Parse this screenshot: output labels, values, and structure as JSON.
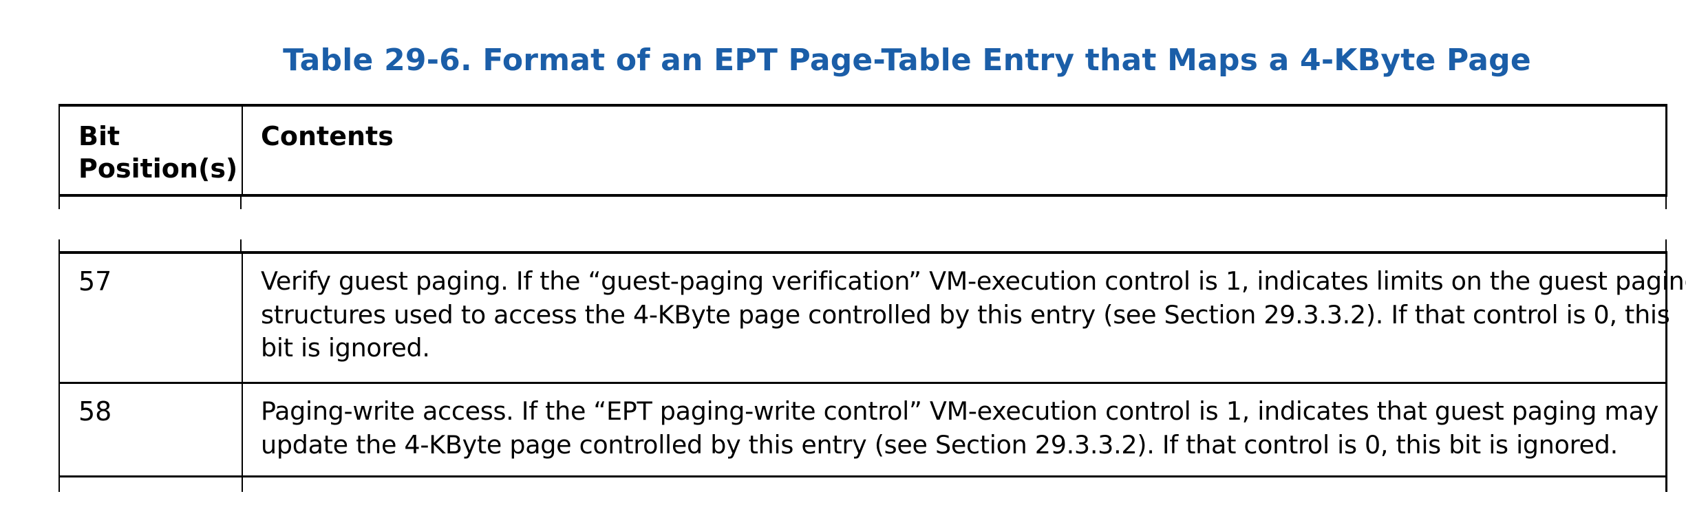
{
  "table": {
    "title": "Table 29-6.  Format of an EPT Page-Table Entry that Maps a 4-KByte Page",
    "headers": {
      "bit_position": "Bit Position(s)",
      "contents": "Contents"
    },
    "rows": [
      {
        "bit": "57",
        "contents_lines": [
          "Verify guest paging. If the “guest-paging verification” VM-execution control is 1, indicates limits on the guest paging",
          "structures used to access the 4-KByte page controlled by this entry (see Section 29.3.3.2). If that control is 0, this",
          "bit is ignored."
        ]
      },
      {
        "bit": "58",
        "contents_lines": [
          "Paging-write access. If the “EPT paging-write control” VM-execution control is 1, indicates that guest paging may",
          "update the 4-KByte page controlled by this entry (see Section 29.3.3.2). If that control is 0, this bit is ignored."
        ]
      }
    ]
  },
  "colors": {
    "title": "#1b5ea8",
    "text": "#000000",
    "rules": "#000000"
  }
}
